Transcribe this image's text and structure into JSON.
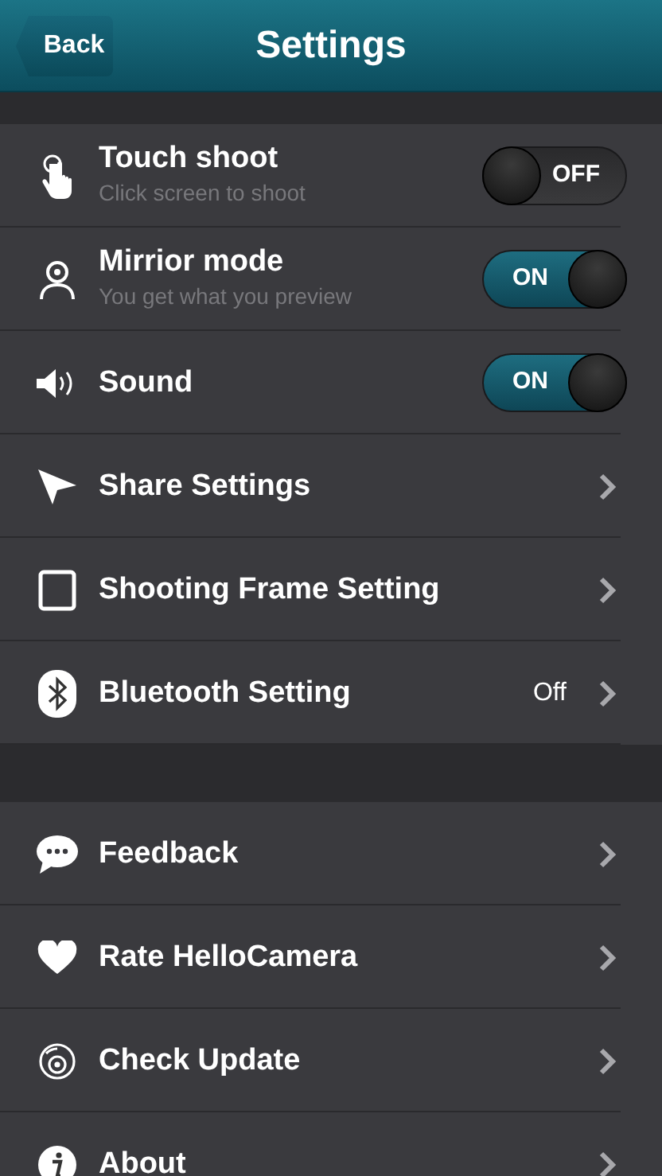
{
  "header": {
    "back": "Back",
    "title": "Settings"
  },
  "groups": [
    {
      "items": [
        {
          "kind": "toggle",
          "title": "Touch shoot",
          "subtitle": "Click screen to shoot",
          "on": false,
          "switch_label": "OFF"
        },
        {
          "kind": "toggle",
          "title": "Mirrior mode",
          "subtitle": "You get what you preview",
          "on": true,
          "switch_label": "ON"
        },
        {
          "kind": "toggle",
          "title": "Sound",
          "on": true,
          "switch_label": "ON"
        },
        {
          "kind": "link",
          "title": "Share Settings"
        },
        {
          "kind": "link",
          "title": "Shooting Frame Setting"
        },
        {
          "kind": "link",
          "title": "Bluetooth Setting",
          "value": "Off"
        }
      ]
    },
    {
      "items": [
        {
          "kind": "link",
          "title": "Feedback"
        },
        {
          "kind": "link",
          "title": "Rate HelloCamera"
        },
        {
          "kind": "link",
          "title": "Check Update"
        },
        {
          "kind": "link",
          "title": "About"
        }
      ]
    }
  ]
}
